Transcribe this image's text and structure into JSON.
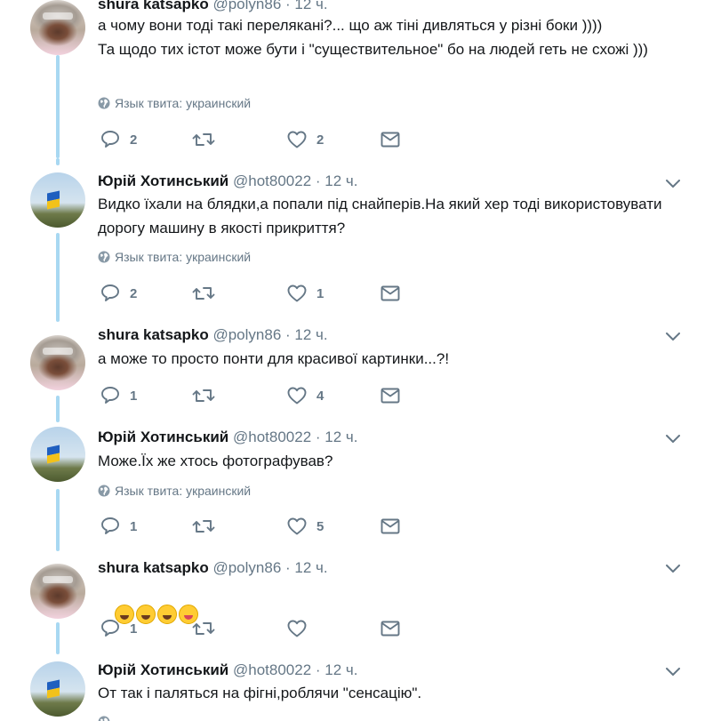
{
  "lang_label": "Язык твита: украинский",
  "tweets": [
    {
      "name": "shura katsapko",
      "handle": "@polyn86",
      "sep": "·",
      "time": "12 ч.",
      "text": "а чому вони тоді такі перелякані?... що аж тіні дивляться у різні боки ))))\nТа щодо тих істот може бути і \"существительное\" бо на людей геть не схожі )))",
      "reply_count": "2",
      "retweet_count": "",
      "like_count": "2"
    },
    {
      "name": "Юрій Хотинський",
      "handle": "@hot80022",
      "sep": "·",
      "time": "12 ч.",
      "text": "Видко їхали на блядки,а попали під снайперів.На який хер тоді використовувати дорогу машину в якості прикриття?",
      "reply_count": "2",
      "retweet_count": "",
      "like_count": "1"
    },
    {
      "name": "shura katsapko",
      "handle": "@polyn86",
      "sep": "·",
      "time": "12 ч.",
      "text": "а може то просто понти для красивої картинки...?!",
      "reply_count": "1",
      "retweet_count": "",
      "like_count": "4"
    },
    {
      "name": "Юрій Хотинський",
      "handle": "@hot80022",
      "sep": "·",
      "time": "12 ч.",
      "text": "Може.Їх же хтось фотографував?",
      "reply_count": "1",
      "retweet_count": "",
      "like_count": "5"
    },
    {
      "name": "shura katsapko",
      "handle": "@polyn86",
      "sep": "·",
      "time": "12 ч.",
      "emojis": [
        "rolling-on-floor-laughing",
        "rolling-on-floor-laughing",
        "rolling-on-floor-laughing",
        "winking-face-with-tongue"
      ],
      "reply_count": "1",
      "retweet_count": "",
      "like_count": ""
    },
    {
      "name": "Юрій Хотинський",
      "handle": "@hot80022",
      "sep": "·",
      "time": "12 ч.",
      "text": "От так і паляться на фігні,роблячи \"сенсацію\".",
      "reply_count": "",
      "retweet_count": "",
      "like_count": ""
    }
  ],
  "colors": {
    "thread_line": "#a8d8f2",
    "icon_gray": "#657786",
    "text": "#14171a"
  }
}
